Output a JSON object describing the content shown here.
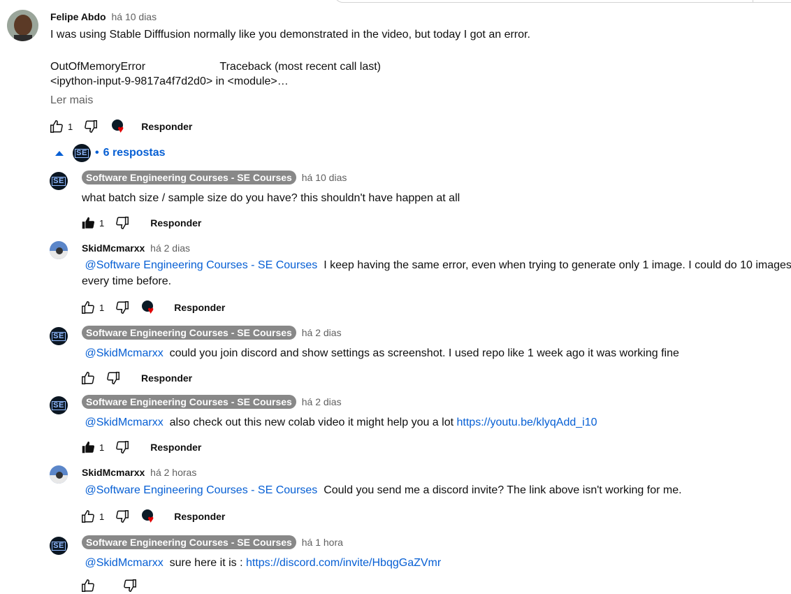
{
  "top_comment": {
    "author": "Felipe Abdo",
    "time": "há 10 dias",
    "line1": "I was using Stable Difffusion normally like you demonstrated in the video, but today I got an error.",
    "line2": "OutOfMemoryError                        Traceback (most recent call last)",
    "line3": "<ipython-input-9-9817a4f7d2d0> in <module>…",
    "read_more": "Ler mais",
    "likes": "1",
    "reply": "Responder",
    "replies_toggle": "6 respostas"
  },
  "replies": [
    {
      "author": "Software Engineering Courses - SE Courses",
      "time": "há 10 dias",
      "mention": "",
      "text": "what batch size / sample size do you have? this shouldn't have happen at all",
      "likes": "1",
      "reply": "Responder"
    },
    {
      "author": "SkidMcmarxx",
      "time": "há 2 dias",
      "mention": "@Software Engineering Courses - SE Courses",
      "text": "I keep having the same error, even when trying to generate only 1 image. I could do 10 images",
      "text2": "every time before.",
      "likes": "1",
      "reply": "Responder"
    },
    {
      "author": "Software Engineering Courses - SE Courses",
      "time": "há 2 dias",
      "mention": "@SkidMcmarxx",
      "text": "could you join discord and show settings as screenshot. I used repo like 1 week ago it was working fine",
      "likes": "",
      "reply": "Responder"
    },
    {
      "author": "Software Engineering Courses - SE Courses",
      "time": "há 2 dias",
      "mention": "@SkidMcmarxx",
      "text": "also check out this new colab video it might help you a lot",
      "link": "https://youtu.be/klyqAdd_i10",
      "likes": "1",
      "reply": "Responder"
    },
    {
      "author": "SkidMcmarxx",
      "time": "há 2 horas",
      "mention": "@Software Engineering Courses - SE Courses",
      "text": "Could you send me a discord invite? The link above isn't working for me.",
      "likes": "1",
      "reply": "Responder"
    },
    {
      "author": "Software Engineering Courses - SE Courses",
      "time": "há 1 hora",
      "mention": "@SkidMcmarxx",
      "text": "sure here it is :",
      "link": "https://discord.com/invite/HbqgGaZVmr"
    }
  ],
  "logo": {
    "text": "SE",
    "sub": "COURSES"
  },
  "colors": {
    "link": "#065fd4",
    "badge": "#888888",
    "heart": "#e00000"
  }
}
